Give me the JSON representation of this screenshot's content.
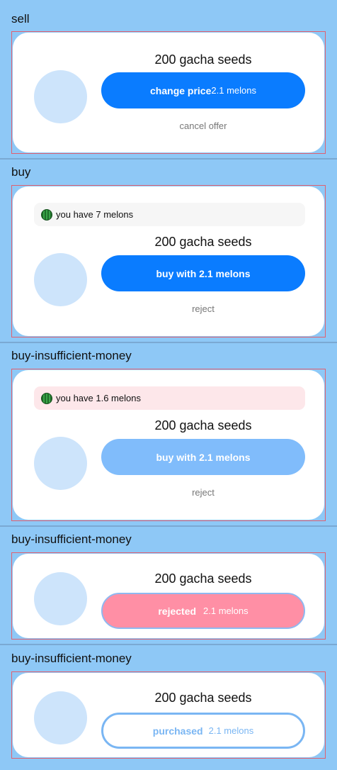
{
  "sections": [
    {
      "label": "sell",
      "title": "200 gacha seeds",
      "button": {
        "label": "change price",
        "price": "2.1 melons"
      },
      "link": "cancel offer"
    },
    {
      "label": "buy",
      "balance": "you have 7 melons",
      "title": "200 gacha seeds",
      "button": {
        "label": "buy with 2.1 melons"
      },
      "link": "reject"
    },
    {
      "label": "buy-insufficient-money",
      "balance": "you have 1.6 melons",
      "title": "200 gacha seeds",
      "button": {
        "label": "buy with 2.1 melons"
      },
      "link": "reject"
    },
    {
      "label": "buy-insufficient-money",
      "title": "200 gacha seeds",
      "button": {
        "label": "rejected",
        "price": "2.1 melons"
      }
    },
    {
      "label": "buy-insufficient-money",
      "title": "200 gacha seeds",
      "button": {
        "label": "purchased",
        "price": "2.1 melons"
      }
    }
  ],
  "icons": {
    "balance": "watermelon-icon"
  },
  "colors": {
    "background": "#8ec8f6",
    "primary": "#0a7cff",
    "disabled": "#80bcfb",
    "rejected": "#ff8fa5",
    "purchased_outline": "#7ab6f3",
    "low_balance_bg": "#fde7ea"
  }
}
